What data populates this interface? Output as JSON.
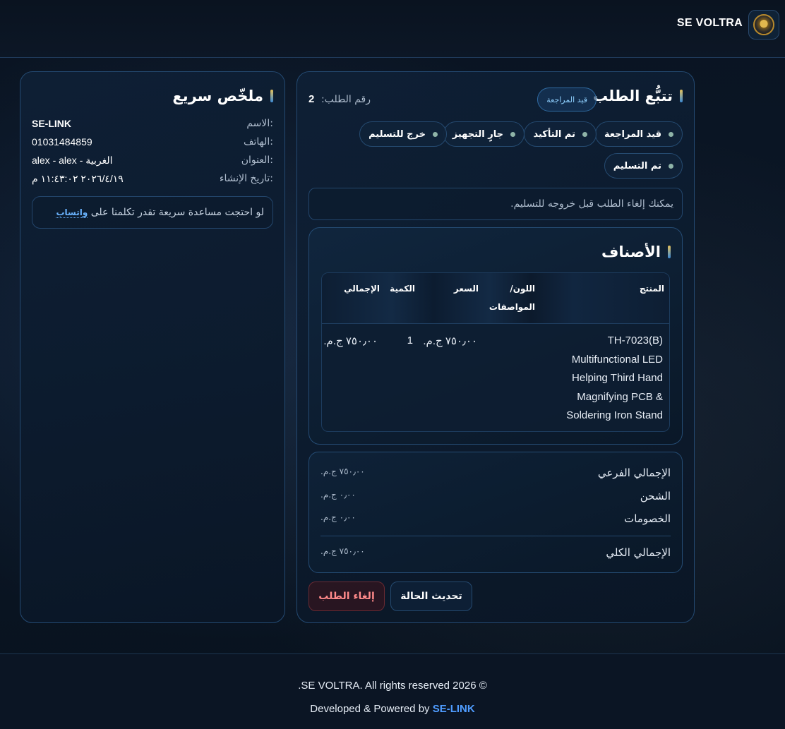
{
  "header": {
    "brand": "SE VOLTRA"
  },
  "summary": {
    "title": "ملخّص سريع",
    "rows": [
      {
        "label": "الاسم:",
        "value": "SE-LINK"
      },
      {
        "label": "الهاتف:",
        "value": "01031484859"
      },
      {
        "label": "العنوان:",
        "value": "alex - alex - الغربية"
      },
      {
        "label": "تاريخ الإنشاء:",
        "value": "٢٠٢٦/٤/١٩ ١١:٤٣:٠٢ م"
      }
    ],
    "help_text": "لو احتجت مساعدة سريعة تقدر تكلمنا على",
    "help_link": "واتساب"
  },
  "tracking": {
    "title": "تتبُّع الطلب",
    "status_badge": "قيد المراجعة",
    "order_no_label": "رقم الطلب:",
    "order_no": "2",
    "steps": [
      "قيد المراجعة",
      "تم التأكيد",
      "جارٍ التجهيز",
      "خرج للتسليم",
      "تم التسليم"
    ],
    "note": "يمكنك إلغاء الطلب قبل خروجه للتسليم."
  },
  "items": {
    "title": "الأصناف",
    "columns": {
      "product": "المنتج",
      "color_line1": "اللون/",
      "color_line2": "المواصفات",
      "price": "السعر",
      "qty": "الكمية",
      "total": "الإجمالي"
    },
    "rows": [
      {
        "product_lines": [
          "TH-7023(B)",
          "Multifunctional LED",
          "Helping Third Hand",
          "Magnifying PCB &",
          "Soldering Iron Stand"
        ],
        "color": "",
        "price": "٧٥٠٫٠٠ ج.م.",
        "qty": "1",
        "total": "٧٥٠٫٠٠ ج.م."
      }
    ]
  },
  "totals": {
    "subtotal_label": "الإجمالي الفرعي",
    "subtotal": "٧٥٠٫٠٠ ج.م.",
    "shipping_label": "الشحن",
    "shipping": "٠٫٠٠ ج.م.",
    "discounts_label": "الخصومات",
    "discounts": "٠٫٠٠ ج.م.",
    "grand_label": "الإجمالي الكلي",
    "grand": "٧٥٠٫٠٠ ج.م."
  },
  "actions": {
    "update": "تحديث الحالة",
    "cancel": "إلغاء الطلب"
  },
  "footer": {
    "copyright": ".SE VOLTRA. All rights reserved 2026 ©",
    "powered_prefix": "Developed & Powered by",
    "powered_link": "SE-LINK"
  },
  "colors": {
    "accent": "#4f9cff",
    "gold": "#e7c25a",
    "danger": "#ff8a8a",
    "panel_border": "#244a72"
  }
}
